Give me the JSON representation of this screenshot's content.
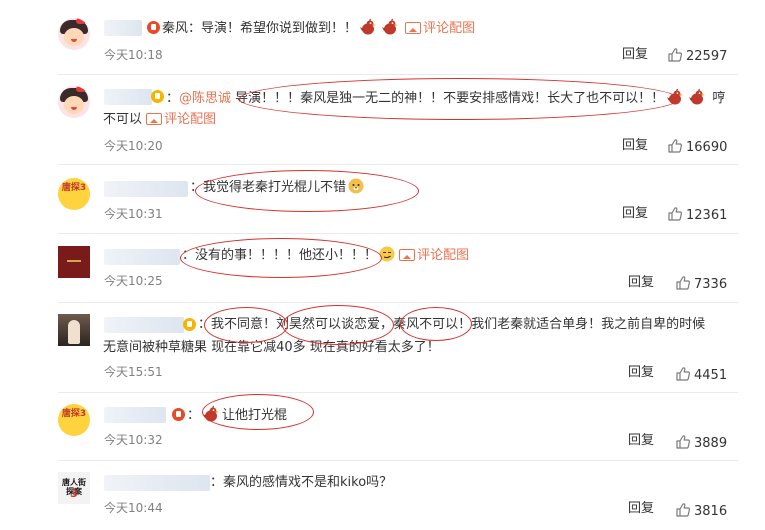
{
  "comments": [
    {
      "text_before": "秦风：导演！希望你说到做到！！",
      "link_pic": "评论配图",
      "time": "今天10:18",
      "reply": "回复",
      "likes": "22597"
    },
    {
      "mention": "@陈思诚",
      "text_line1": "导演！！！秦风是独一无二的神！！不要安排感情戏！长大了也不可以！！",
      "text_line1_tail": "哼",
      "text_line2": "不可以",
      "link_pic": "评论配图",
      "time": "今天10:20",
      "reply": "回复",
      "likes": "16690"
    },
    {
      "text": "我觉得老秦打光棍儿不错",
      "time": "今天10:31",
      "reply": "回复",
      "likes": "12361"
    },
    {
      "text": "没有的事！！！！他还小！！！",
      "link_pic": "评论配图",
      "time": "今天10:25",
      "reply": "回复",
      "likes": "7336"
    },
    {
      "seg1": "我不同意！",
      "seg2": "刘昊然可以谈恋爱",
      "seg3": "，",
      "seg4": "秦风不可以",
      "seg5": "！我们老秦就适合单身！我之前自卑的时候",
      "line2": "无意间被种草糖果 现在靠它减40多 现在真的好看太多了！",
      "time": "今天15:51",
      "reply": "回复",
      "likes": "4451"
    },
    {
      "text": "让他打光棍",
      "time": "今天10:32",
      "reply": "回复",
      "likes": "3889"
    },
    {
      "text": "秦风的感情戏不是和kiko吗？",
      "time": "今天10:44",
      "reply": "回复",
      "likes": "3816"
    }
  ],
  "avatars": {
    "badge_text": "唐探3",
    "poster_title": "唐人街探案",
    "poster_num": "3"
  },
  "colors": {
    "link": "#eb7350",
    "time": "#808080",
    "annotation": "#d9302c"
  }
}
